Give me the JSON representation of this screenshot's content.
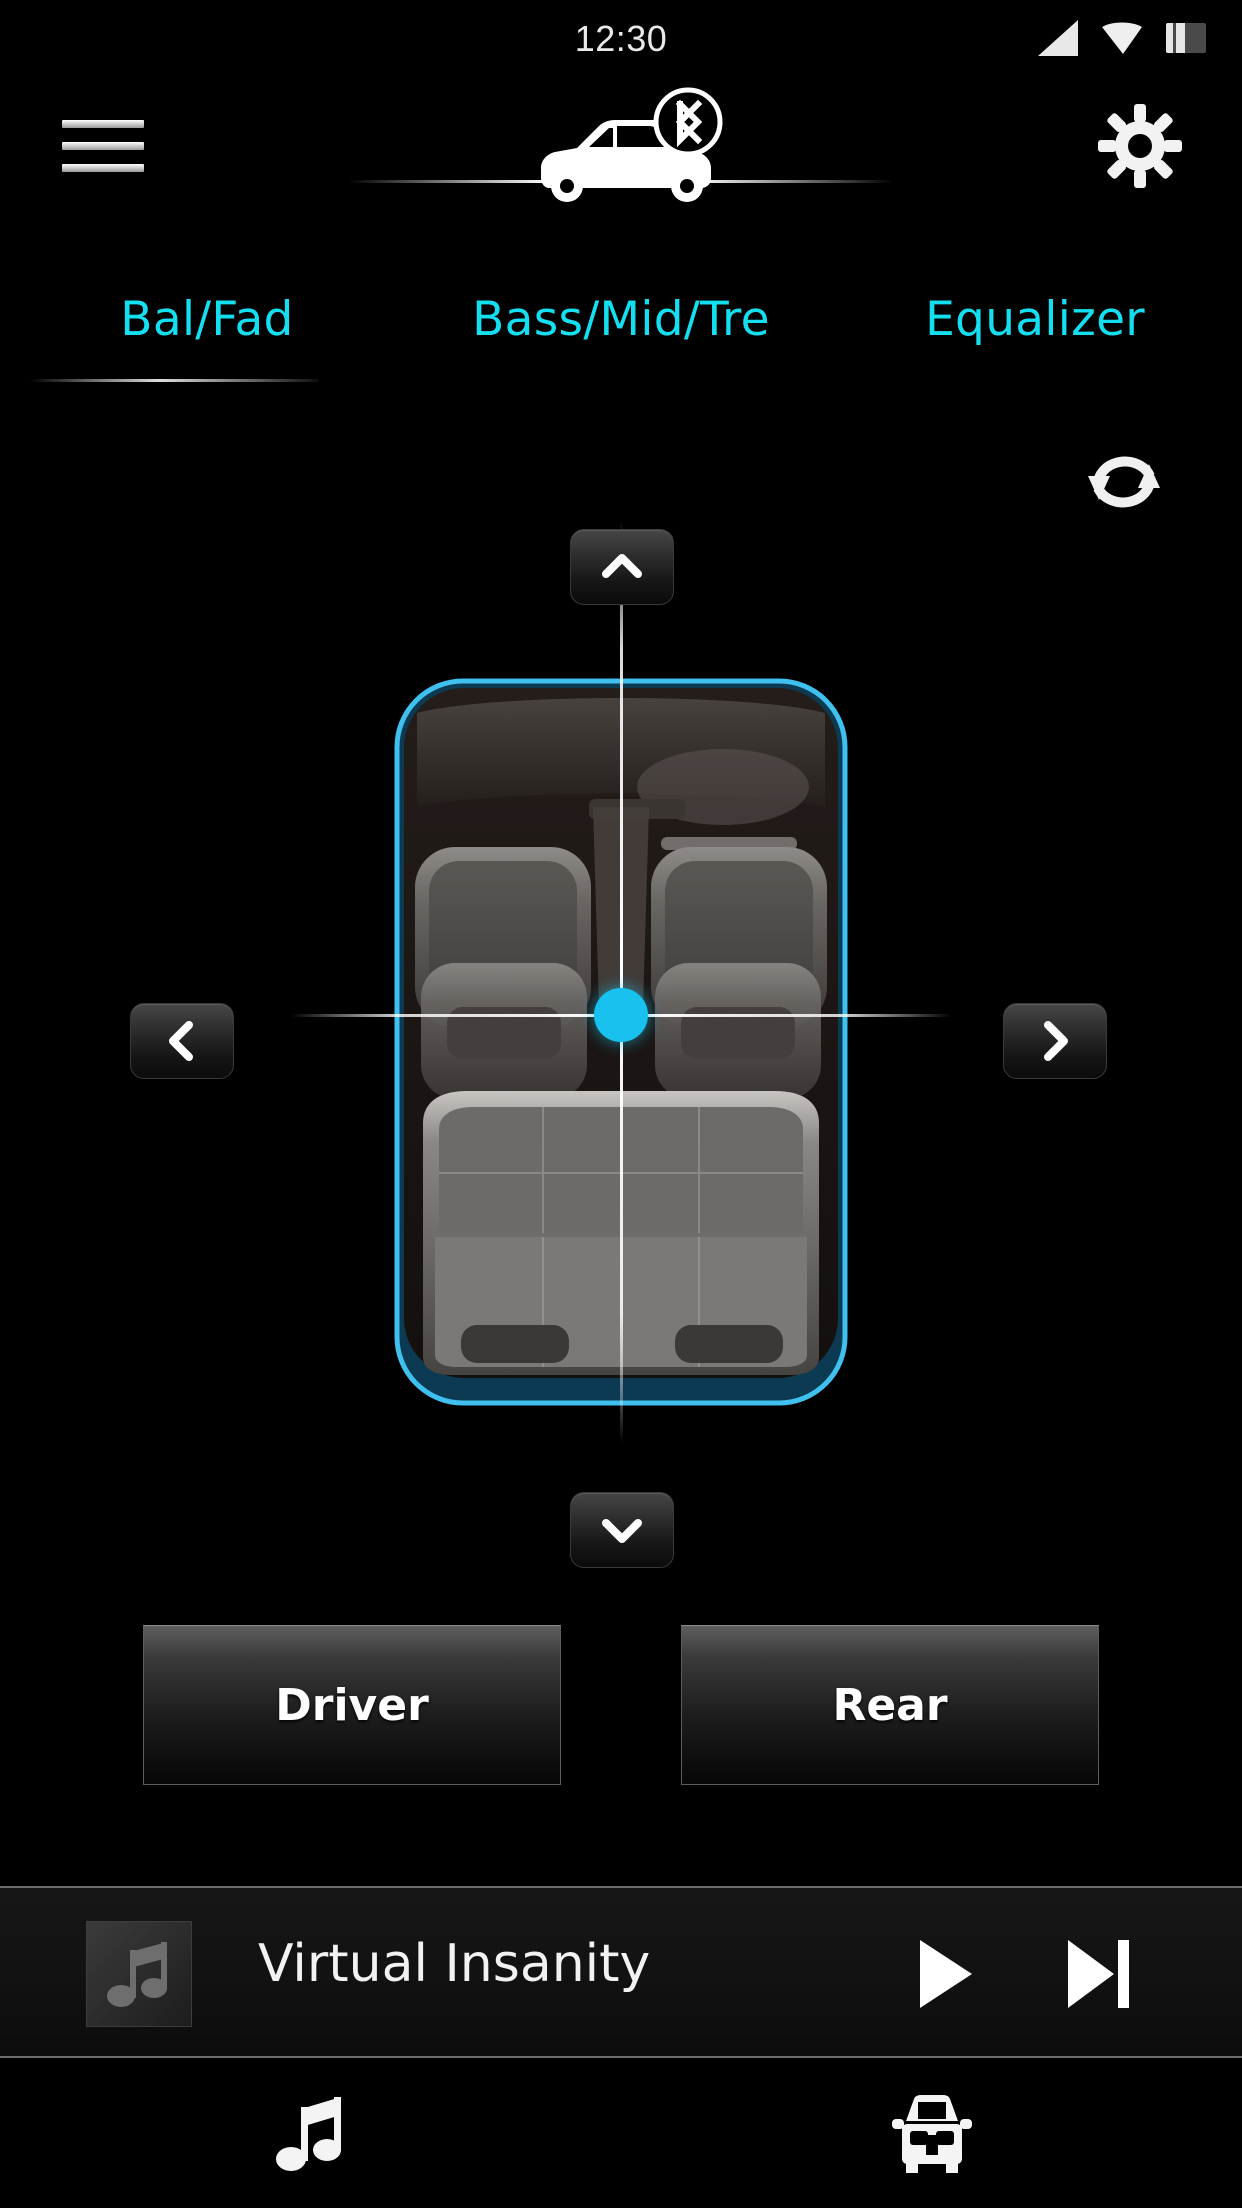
{
  "statusbar": {
    "clock": "12:30",
    "icons": [
      "signal-icon",
      "wifi-icon",
      "battery-icon"
    ]
  },
  "header": {
    "menu_icon": "hamburger-menu-icon",
    "settings_icon": "gear-icon",
    "vehicle_icon": "car-side-icon",
    "connection_icon": "bluetooth-icon"
  },
  "tabs": [
    {
      "label": "Bal/Fad",
      "active": true
    },
    {
      "label": "Bass/Mid/Tre",
      "active": false
    },
    {
      "label": "Equalizer",
      "active": false
    }
  ],
  "toolbar": {
    "reset_icon": "refresh-reset-icon"
  },
  "fader": {
    "up_icon": "chevron-up-icon",
    "down_icon": "chevron-down-icon",
    "left_icon": "chevron-left-icon",
    "right_icon": "chevron-right-icon",
    "diagram_icon": "car-interior-top-view",
    "balance_value": "0",
    "fade_value": "0",
    "dot_color": "#19c2ee",
    "vehicle_outline_color": "#1e9ed2"
  },
  "presets": [
    {
      "label": "Driver"
    },
    {
      "label": "Rear"
    }
  ],
  "now_playing": {
    "title": "Virtual Insanity",
    "art_icon": "music-note-icon",
    "play_icon": "play-icon",
    "next_icon": "skip-next-icon"
  },
  "bottom_nav": [
    {
      "icon": "music-note-icon",
      "name": "media"
    },
    {
      "icon": "car-front-icon",
      "name": "vehicle"
    }
  ],
  "colors": {
    "accent_cyan": "#14dff0",
    "dot_cyan": "#19c2ee",
    "background": "#000000"
  }
}
